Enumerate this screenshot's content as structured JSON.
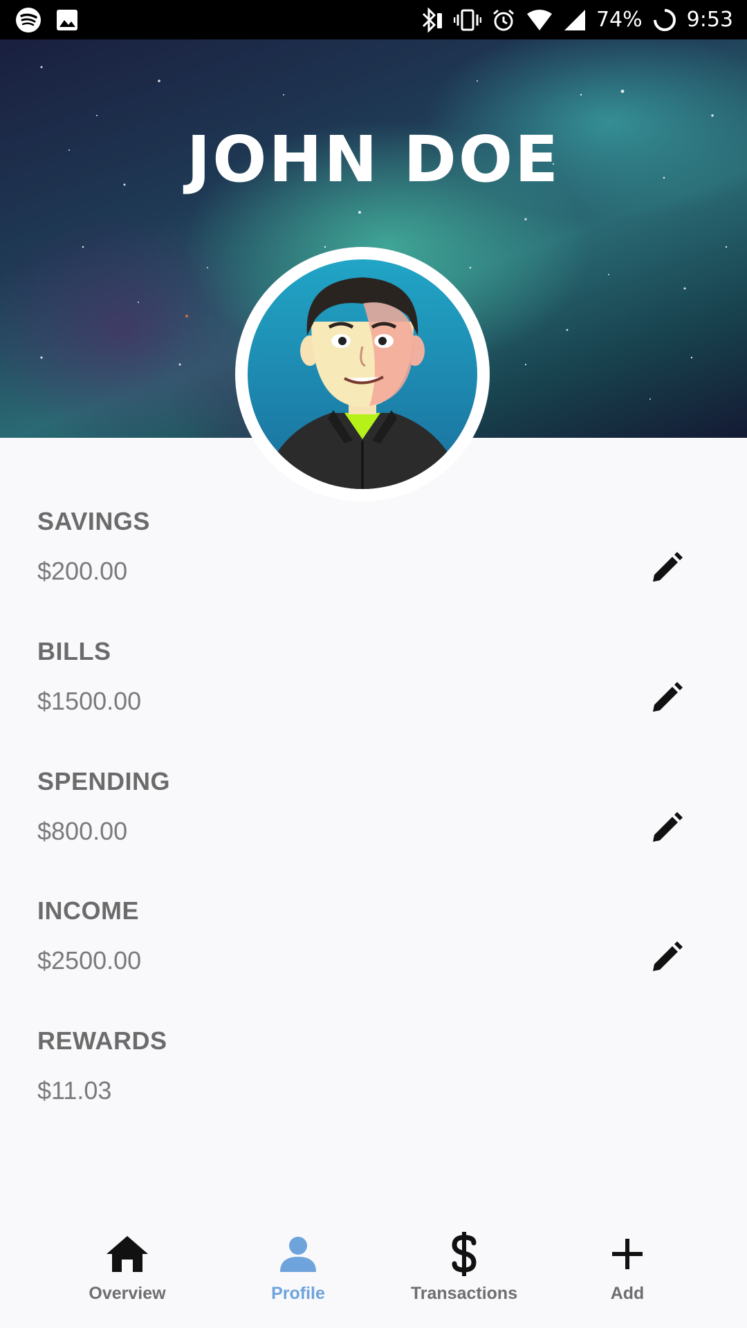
{
  "status_bar": {
    "battery": "74%",
    "time": "9:53",
    "icons": [
      "spotify-icon",
      "image-icon",
      "bluetooth-icon",
      "vibrate-icon",
      "alarm-icon",
      "wifi-icon",
      "signal-icon",
      "battery-icon"
    ]
  },
  "profile": {
    "name": "JOHN DOE"
  },
  "accounts": [
    {
      "label": "SAVINGS",
      "value": "$200.00",
      "editable": true
    },
    {
      "label": "BILLS",
      "value": "$1500.00",
      "editable": true
    },
    {
      "label": "SPENDING",
      "value": "$800.00",
      "editable": true
    },
    {
      "label": "INCOME",
      "value": "$2500.00",
      "editable": true
    },
    {
      "label": "REWARDS",
      "value": "$11.03",
      "editable": false
    }
  ],
  "nav": {
    "items": [
      {
        "label": "Overview",
        "icon": "home-icon",
        "active": false
      },
      {
        "label": "Profile",
        "icon": "person-icon",
        "active": true
      },
      {
        "label": "Transactions",
        "icon": "dollar-icon",
        "active": false
      },
      {
        "label": "Add",
        "icon": "plus-icon",
        "active": false
      }
    ],
    "active_color": "#6ea3dc",
    "inactive_color": "#6e6e6e"
  }
}
